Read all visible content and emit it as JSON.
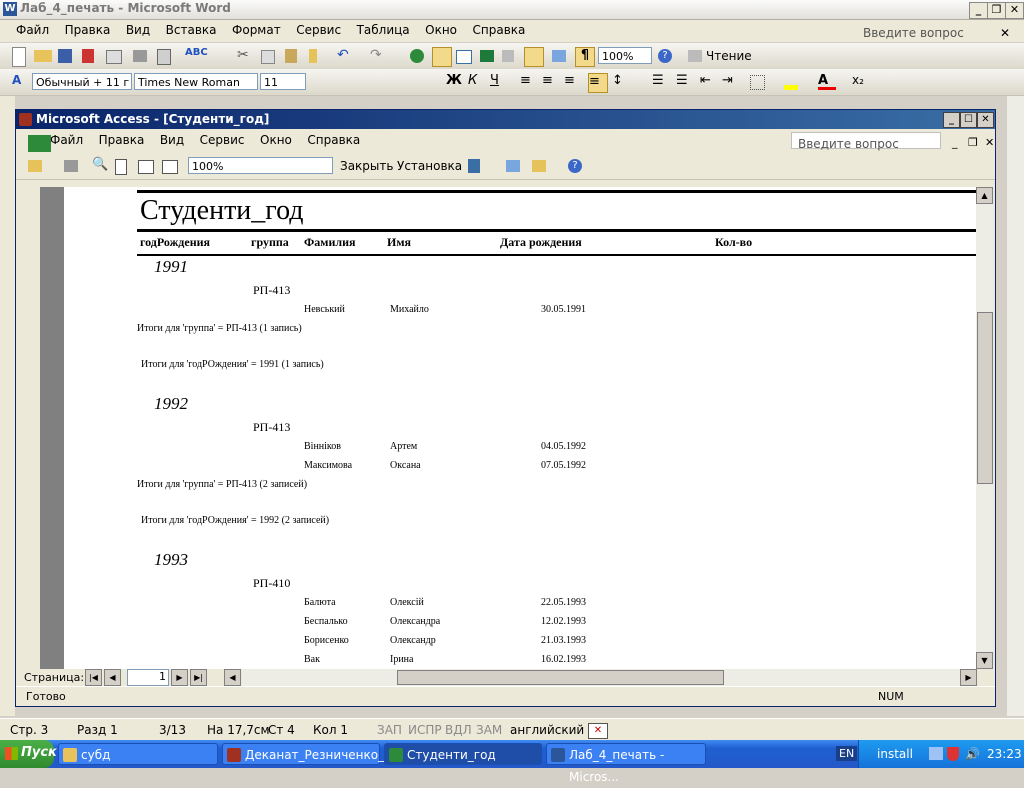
{
  "word": {
    "title": "Лаб_4_печать - Microsoft Word",
    "menu": [
      "Файл",
      "Правка",
      "Вид",
      "Вставка",
      "Формат",
      "Сервис",
      "Таблица",
      "Окно",
      "Справка"
    ],
    "question": "Введите вопрос",
    "zoom": "100%",
    "read_label": "Чтение",
    "style": "Обычный + 11 г",
    "font": "Times New Roman",
    "size": "11",
    "status": {
      "page": "Стр. 3",
      "section": "Разд 1",
      "pages": "3/13",
      "at": "На 17,7см",
      "line": "Ст 4",
      "col": "Кол 1",
      "rec": "ЗАП",
      "trk": "ИСПР",
      "ext": "ВДЛ",
      "ovr": "ЗАМ",
      "lang": "английский"
    }
  },
  "access": {
    "title": "Microsoft Access - [Студенти_год]",
    "menu": [
      "Файл",
      "Правка",
      "Вид",
      "Сервис",
      "Окно",
      "Справка"
    ],
    "question": "Введите вопрос",
    "zoom": "100%",
    "close_label": "Закрыть",
    "setup_label": "Установка",
    "page_label": "Страница:",
    "page_value": "1",
    "status_left": "Готово",
    "status_num": "NUM"
  },
  "report": {
    "title": "Студенти_год",
    "headers": {
      "year": "годРождения",
      "group": "группа",
      "surname": "Фамилия",
      "name": "Имя",
      "dob": "Дата рождения",
      "count": "Кол-во"
    },
    "groups": [
      {
        "year": "1991",
        "group": "РП-413",
        "rows": [
          {
            "surname": "Невський",
            "name": "Михайло",
            "dob": "30.05.1991"
          }
        ],
        "group_total": "Итоги для 'группа' =  РП-413 (1 запись)",
        "year_total": "Итоги для 'годРОждения' =  1991 (1 запись)"
      },
      {
        "year": "1992",
        "group": "РП-413",
        "rows": [
          {
            "surname": "Вінніков",
            "name": "Артем",
            "dob": "04.05.1992"
          },
          {
            "surname": "Максимова",
            "name": "Оксана",
            "dob": "07.05.1992"
          }
        ],
        "group_total": "Итоги для 'группа' =  РП-413 (2 записей)",
        "year_total": "Итоги для 'годРОждения' =  1992 (2 записей)"
      },
      {
        "year": "1993",
        "group": "РП-410",
        "rows": [
          {
            "surname": "Балюта",
            "name": "Олексій",
            "dob": "22.05.1993"
          },
          {
            "surname": "Беспалько",
            "name": "Олександра",
            "dob": "12.02.1993"
          },
          {
            "surname": "Борисенко",
            "name": "Олександр",
            "dob": "21.03.1993"
          },
          {
            "surname": "Вак",
            "name": "Ірина",
            "dob": "16.02.1993"
          }
        ]
      }
    ]
  },
  "taskbar": {
    "start": "Пуск",
    "items": [
      "субд",
      "Деканат_Резниченко_...",
      "Студенти_год",
      "Лаб_4_печать - Micros..."
    ],
    "lang": "EN",
    "install": "install",
    "time": "23:23"
  }
}
